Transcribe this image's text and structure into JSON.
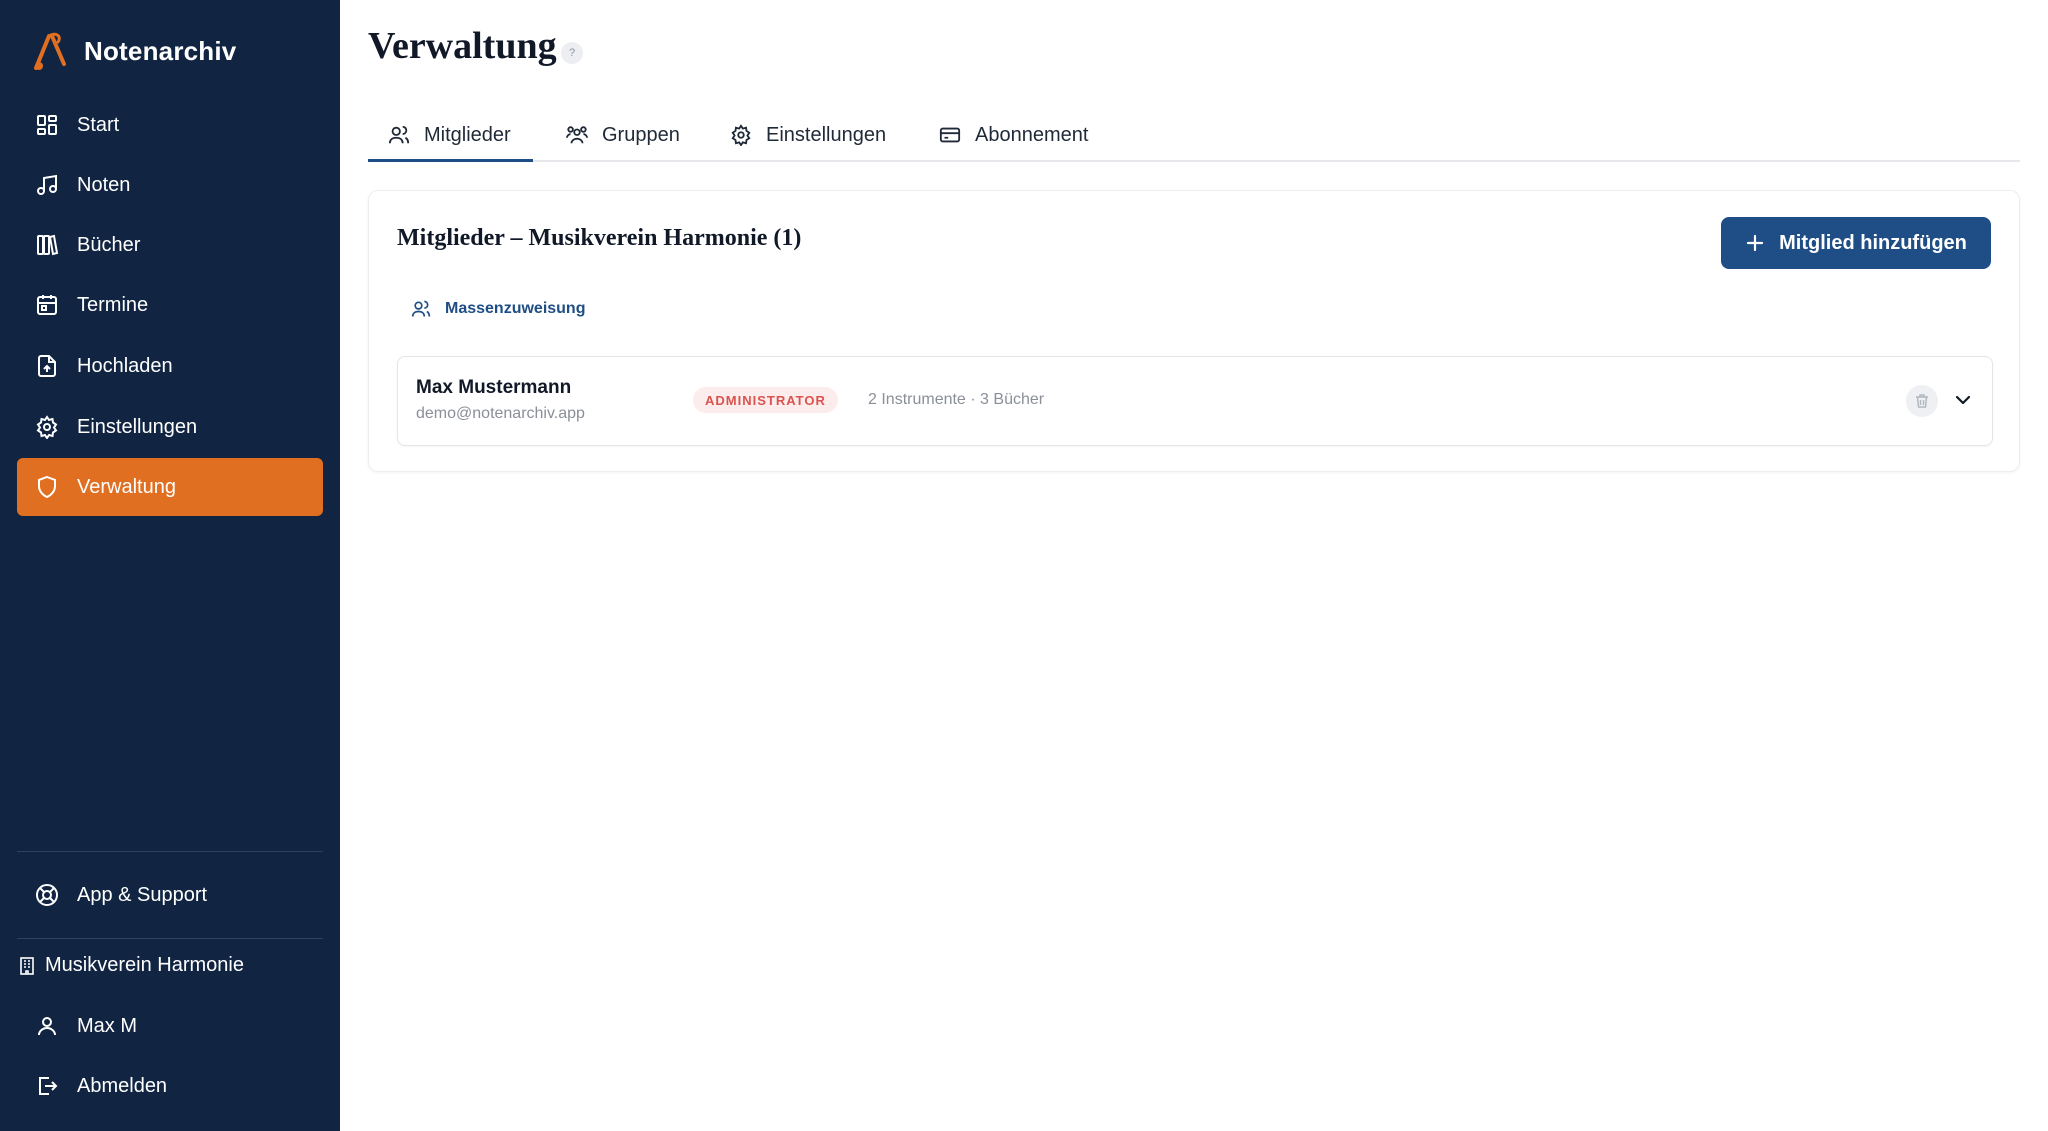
{
  "app": {
    "name": "Notenarchiv"
  },
  "sidebar": {
    "items": [
      {
        "label": "Start",
        "icon": "dashboard-icon"
      },
      {
        "label": "Noten",
        "icon": "music-note-icon"
      },
      {
        "label": "Bücher",
        "icon": "books-icon"
      },
      {
        "label": "Termine",
        "icon": "calendar-icon"
      },
      {
        "label": "Hochladen",
        "icon": "file-upload-icon"
      },
      {
        "label": "Einstellungen",
        "icon": "gear-icon"
      },
      {
        "label": "Verwaltung",
        "icon": "shield-icon",
        "active": true
      }
    ],
    "support": {
      "label": "App & Support",
      "icon": "lifebuoy-icon"
    },
    "organization": {
      "label": "Musikverein Harmonie",
      "icon": "building-icon"
    },
    "user": {
      "label": "Max M",
      "icon": "user-icon"
    },
    "logout": {
      "label": "Abmelden",
      "icon": "logout-icon"
    }
  },
  "page": {
    "title": "Verwaltung",
    "help": "?"
  },
  "tabs": [
    {
      "label": "Mitglieder",
      "icon": "users-icon",
      "active": true
    },
    {
      "label": "Gruppen",
      "icon": "group-icon"
    },
    {
      "label": "Einstellungen",
      "icon": "gear-icon"
    },
    {
      "label": "Abonnement",
      "icon": "credit-card-icon"
    }
  ],
  "members": {
    "title": "Mitglieder – Musikverein Harmonie (1)",
    "add_label": "Mitglied hinzufügen",
    "mass_assign_label": "Massenzuweisung",
    "rows": [
      {
        "name": "Max Mustermann",
        "email": "demo@notenarchiv.app",
        "role": "ADMINISTRATOR",
        "meta": "2 Instrumente · 3 Bücher"
      }
    ]
  },
  "colors": {
    "sidebar_bg": "#112542",
    "accent": "#e06f22",
    "primary": "#1f4e86",
    "admin_badge_bg": "#fdecec",
    "admin_badge_text": "#d9534f"
  }
}
